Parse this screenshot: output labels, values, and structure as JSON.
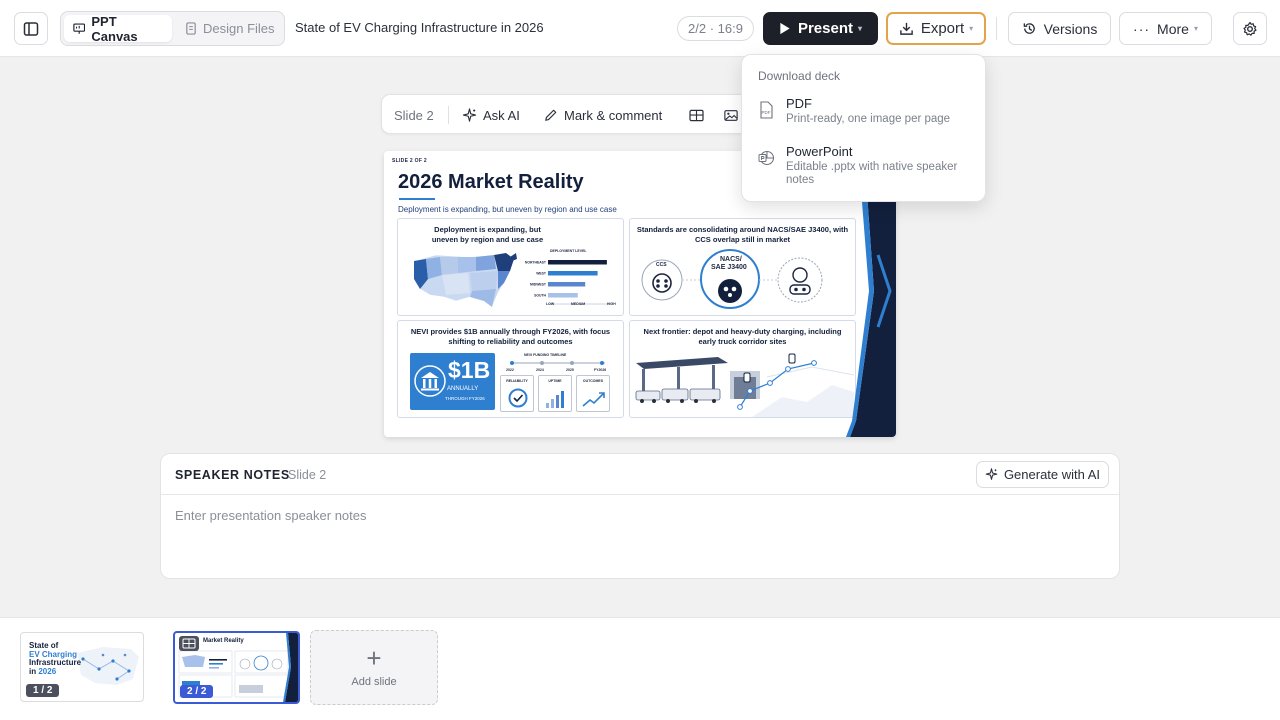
{
  "header": {
    "tabs": [
      {
        "label": "PPT Canvas",
        "active": true
      },
      {
        "label": "Design Files",
        "active": false
      }
    ],
    "doc_title": "State of EV Charging Infrastructure in 2026",
    "page_indicator": "2/2 · 16:9",
    "present_label": "Present",
    "export_label": "Export",
    "versions_label": "Versions",
    "more_label": "More"
  },
  "slide_toolbar": {
    "slide_label": "Slide 2",
    "ask_ai_label": "Ask AI",
    "mark_comment_label": "Mark & comment"
  },
  "slide": {
    "kicker": "SLIDE 2 OF 2",
    "title": "2026 Market Reality",
    "subtitle": "Deployment is expanding, but uneven by region and use case",
    "quad1": {
      "title": "Deployment is expanding, but uneven by region and use case",
      "legend_title": "DEPLOYMENT LEVEL",
      "rows": [
        "NORTHEAST",
        "WEST",
        "MIDWEST",
        "SOUTH"
      ],
      "levels": [
        0.95,
        0.8,
        0.6,
        0.48
      ],
      "axis": [
        "LOW",
        "MEDIUM",
        "HIGH"
      ]
    },
    "quad2": {
      "title": "Standards are consolidating around NACS/SAE J3400, with CCS overlap still in market",
      "ccs_label": "CCS",
      "nacs_label_1": "NACS/",
      "nacs_label_2": "SAE J3400"
    },
    "quad3": {
      "title": "NEVI provides $1B annually through FY2026, with focus shifting to reliability and outcomes",
      "amount": "$1B",
      "amount_l1": "ANNUALLY",
      "amount_l2": "THROUGH FY2026",
      "timeline_title": "NEVI FUNDING TIMELINE",
      "years": [
        "2022",
        "2024",
        "2025",
        "FY2026"
      ],
      "metrics": [
        "RELIABILITY",
        "UPTIME",
        "OUTCOMES"
      ]
    },
    "quad4": {
      "title": "Next frontier: depot and heavy-duty charging, including early truck corridor sites"
    }
  },
  "export_menu": {
    "heading": "Download deck",
    "items": [
      {
        "label": "PDF",
        "desc": "Print-ready, one image per page",
        "icon": "pdf-file-icon",
        "icon_text": "PDF"
      },
      {
        "label": "PowerPoint",
        "desc": "Editable .pptx with native speaker notes",
        "icon": "powerpoint-icon"
      }
    ]
  },
  "notes": {
    "title": "SPEAKER NOTES",
    "slide_label": "Slide 2",
    "generate_label": "Generate with AI",
    "placeholder": "Enter presentation speaker notes",
    "value": ""
  },
  "filmstrip": {
    "slides": [
      {
        "badge": "1 / 2",
        "title_lines": [
          "State of",
          "EV Charging",
          "Infrastructure",
          "in 2026"
        ],
        "highlight_words": [
          "EV Charging",
          "2026"
        ]
      },
      {
        "badge": "2 / 2",
        "title": "Market Reality",
        "selected": true
      }
    ],
    "add_label": "Add slide",
    "add_symbol": "+"
  },
  "colors": {
    "accent_orange": "#e1a44a",
    "present_dark": "#1d2029",
    "selection_blue": "#3b5bd6",
    "slide_blue": "#2f7fd1",
    "slide_navy": "#13203d"
  }
}
